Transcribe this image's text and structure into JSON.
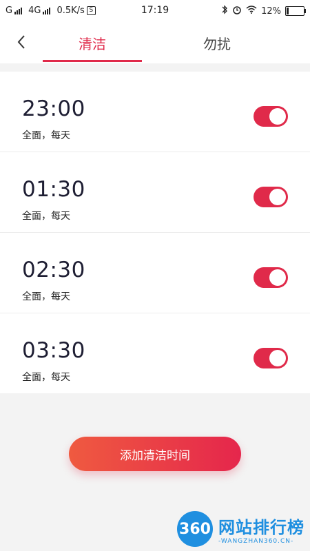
{
  "status_bar": {
    "carrier1": "G",
    "carrier2": "4G",
    "speed": "0.5K/s",
    "speed_icon": "S",
    "time": "17:19",
    "battery_percent": "12%",
    "battery_level": 0.12
  },
  "tabs": [
    {
      "label": "清洁",
      "active": true
    },
    {
      "label": "勿扰",
      "active": false
    }
  ],
  "schedules": [
    {
      "time": "23:00",
      "detail": "全面，每天",
      "enabled": true
    },
    {
      "time": "01:30",
      "detail": "全面，每天",
      "enabled": true
    },
    {
      "time": "02:30",
      "detail": "全面，每天",
      "enabled": true
    },
    {
      "time": "03:30",
      "detail": "全面，每天",
      "enabled": true
    }
  ],
  "add_button": {
    "label": "添加清洁时间"
  },
  "watermark": {
    "logo": "360",
    "title": "网站排行榜",
    "url": "-WANGZHAN360.CN-"
  },
  "colors": {
    "accent": "#e02a4a",
    "brand": "#1f8fe0"
  }
}
